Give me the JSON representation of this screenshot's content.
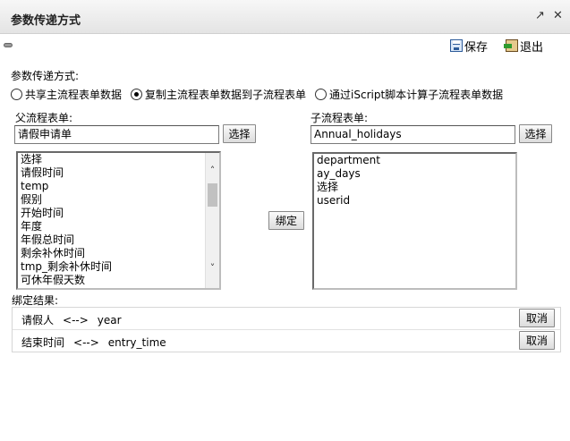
{
  "window": {
    "title": "参数传递方式",
    "popout_icon": "external-link-icon",
    "close_icon": "close-icon"
  },
  "toolbar": {
    "save_label": "保存",
    "exit_label": "退出"
  },
  "mode": {
    "label": "参数传递方式:",
    "options": [
      {
        "label": "共享主流程表单数据",
        "checked": false
      },
      {
        "label": "复制主流程表单数据到子流程表单",
        "checked": true
      },
      {
        "label": "通过iScript脚本计算子流程表单数据",
        "checked": false
      }
    ]
  },
  "parent": {
    "label": "父流程表单:",
    "value": "请假申请单",
    "select_label": "选择",
    "fields": [
      "选择",
      "请假时间",
      "temp",
      "假别",
      "开始时间",
      "年度",
      "年假总时间",
      "剩余补休时间",
      "tmp_剩余补休时间",
      "可休年假天数"
    ]
  },
  "child": {
    "label": "子流程表单:",
    "value": "Annual_holidays",
    "select_label": "选择",
    "fields": [
      "department",
      "ay_days",
      "选择",
      "userid"
    ]
  },
  "bind_label": "绑定",
  "results": {
    "label": "绑定结果:",
    "arrow": "<-->",
    "cancel_label": "取消",
    "rows": [
      {
        "left": "请假人",
        "right": "year"
      },
      {
        "left": "结束时间",
        "right": "entry_time"
      }
    ]
  }
}
